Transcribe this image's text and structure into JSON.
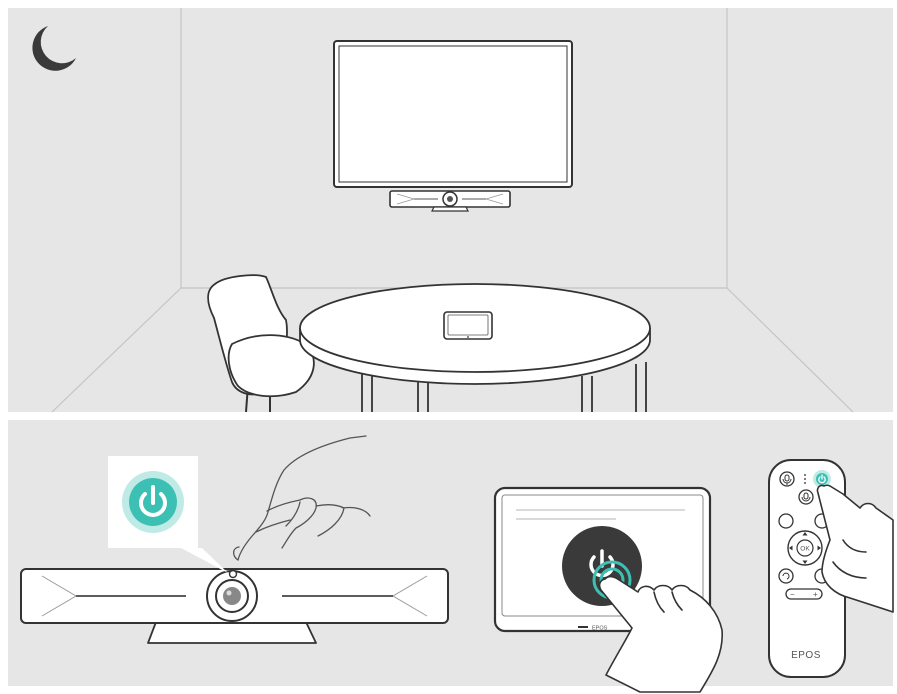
{
  "brand_label": "EPOS",
  "screen_brand_label": "EPOS",
  "remote_ok_label": "OK",
  "remote_minus_label": "−",
  "remote_plus_label": "+",
  "icons": {
    "standby": "moon-icon",
    "power": "power-icon",
    "mute": "mic-icon",
    "back": "back-arrow-icon"
  },
  "colors": {
    "panel_bg": "#e6e6e6",
    "device_fill": "#ffffff",
    "outline": "#333333",
    "accent_teal": "#3cc0b4",
    "teal_light": "#bfeae6",
    "power_button_dark": "#3a3a3a"
  }
}
